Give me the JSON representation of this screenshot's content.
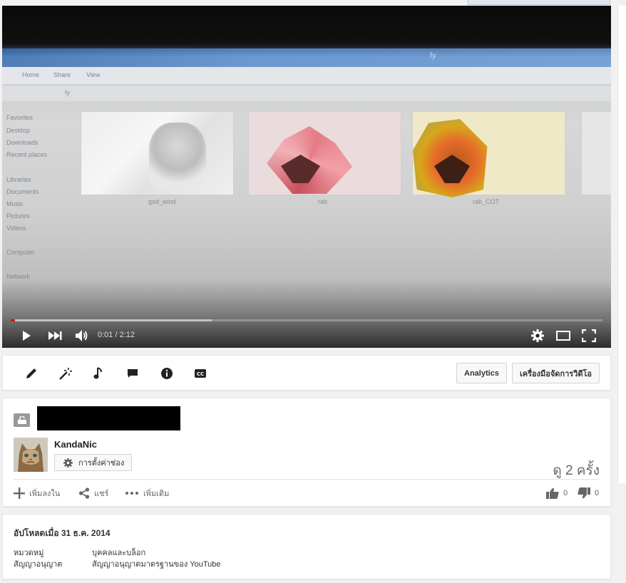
{
  "player": {
    "explorer": {
      "window_title": "fy",
      "ribbon_tabs": [
        "Home",
        "Share",
        "View"
      ],
      "address": "fy",
      "nav_items": [
        "Favorites",
        "Desktop",
        "Downloads",
        "Recent places",
        "Libraries",
        "Documents",
        "Music",
        "Pictures",
        "Videos",
        "Computer",
        "Network"
      ],
      "thumbnails": [
        "god_wind",
        "rab",
        "rab_COT"
      ]
    },
    "time_display": "0:01 / 2:12",
    "progress_played": 0.005,
    "progress_buffered": 0.34
  },
  "toolbar": {
    "tools": [
      "pencil-icon",
      "magic-wand-icon",
      "music-note-icon",
      "comment-icon",
      "info-icon",
      "cc-icon"
    ],
    "analytics_label": "Analytics",
    "video_manager_label": "เครื่องมือจัดการวิดีโอ"
  },
  "info": {
    "channel_name": "KandaNic",
    "channel_settings_label": "การตั้งค่าช่อง",
    "view_count": "ดู 2 ครั้ง",
    "add_to_label": "เพิ่มลงใน",
    "share_label": "แชร์",
    "more_label": "เพิ่มเติม",
    "likes": "0",
    "dislikes": "0"
  },
  "details": {
    "upload_date": "อัปโหลดเมื่อ 31 ธ.ค. 2014",
    "category_label": "หมวดหมู่",
    "category_value": "บุคคลและบล็อก",
    "license_label": "สัญญาอนุญาต",
    "license_value": "สัญญาอนุญาตมาตรฐานของ YouTube"
  },
  "colors": {
    "progress_played": "#cc181e",
    "page_bg": "#f1f1f1"
  }
}
